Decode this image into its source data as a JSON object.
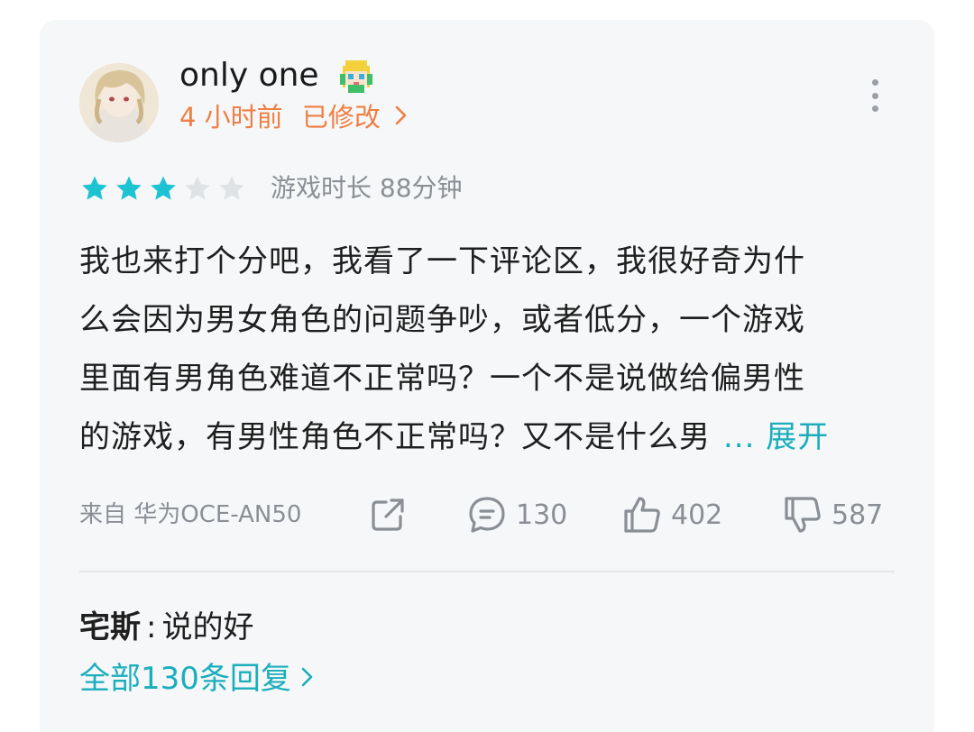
{
  "review": {
    "username": "only one",
    "badge_icon": "pixel-character-badge-icon",
    "time": "4 小时前",
    "edited": "已修改",
    "rating": 3,
    "max_rating": 5,
    "star_color_on": "#1ec3d3",
    "star_color_off": "#dfe3e6",
    "playtime": "游戏时长 88分钟",
    "content_lines": [
      "我也来打个分吧，我看了一下评论区，我很好奇为什",
      "么会因为男女角色的问题争吵，或者低分，一个游戏",
      "里面有男角色难道不正常吗？一个不是说做给偏男性",
      "的游戏，有男性角色不正常吗？又不是什么男"
    ],
    "expand_label": "... 展开",
    "device": "来自 华为OCE-AN50",
    "comments": "130",
    "likes": "402",
    "dislikes": "587"
  },
  "reply": {
    "author": "宅斯",
    "separator": ":",
    "text": "说的好",
    "all_replies_label": "全部130条回复"
  },
  "colors": {
    "accent": "#1aaebc",
    "time_orange": "#ee7f44",
    "muted": "#8a8f95"
  }
}
